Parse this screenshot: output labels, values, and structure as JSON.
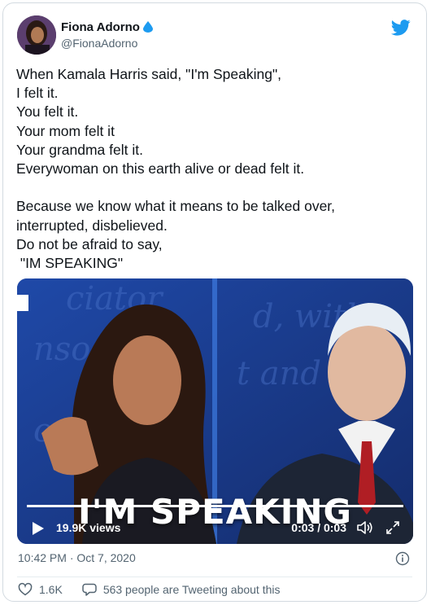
{
  "author": {
    "name": "Fiona Adorno",
    "handle": "@FionaAdorno"
  },
  "tweet": {
    "lines": [
      "When Kamala Harris said, \"I'm Speaking\",",
      "I felt it.",
      "You felt it.",
      "Your mom felt it",
      "Your grandma felt it.",
      "Everywoman on this earth alive or dead felt it.",
      "",
      "Because we know what it means to be talked over,",
      "interrupted, disbelieved.",
      "Do not be afraid to say,",
      " \"IM SPEAKING\""
    ]
  },
  "video": {
    "caption": "I'M SPEAKING",
    "views": "19.9K views",
    "time": "0:03 / 0:03",
    "progress": 1.0
  },
  "timestamp": "10:42 PM · Oct 7, 2020",
  "actions": {
    "likes": "1.6K",
    "tweeting": "563 people are Tweeting about this"
  },
  "icons": [
    "verified-drop-icon",
    "twitter-bird-icon",
    "play-icon",
    "volume-icon",
    "fullscreen-icon",
    "info-icon",
    "heart-icon",
    "comment-icon"
  ],
  "colors": {
    "brand": "#1d9bf0",
    "text": "#0f1419",
    "muted": "#536471"
  }
}
